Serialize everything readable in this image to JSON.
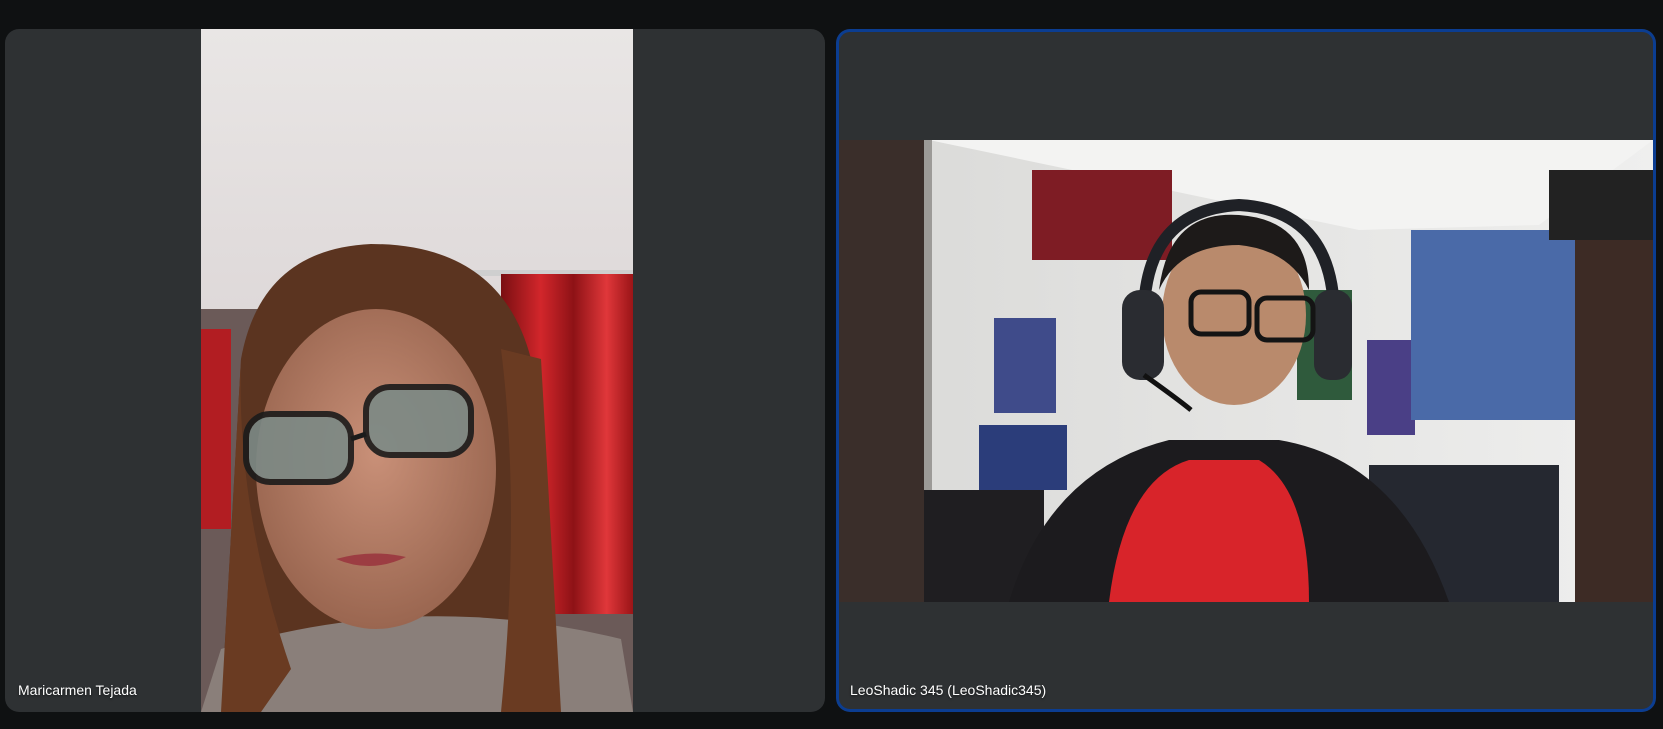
{
  "participants": [
    {
      "name": "Maricarmen Tejada",
      "video_icon": "person-video"
    },
    {
      "name": "LeoShadic 345 (LeoShadic345)",
      "video_icon": "person-video",
      "active_speaker": true
    }
  ],
  "colors": {
    "background": "#0f1112",
    "tile": "#2e3133",
    "active_border": "#0b3d91",
    "label": "#ffffff"
  }
}
